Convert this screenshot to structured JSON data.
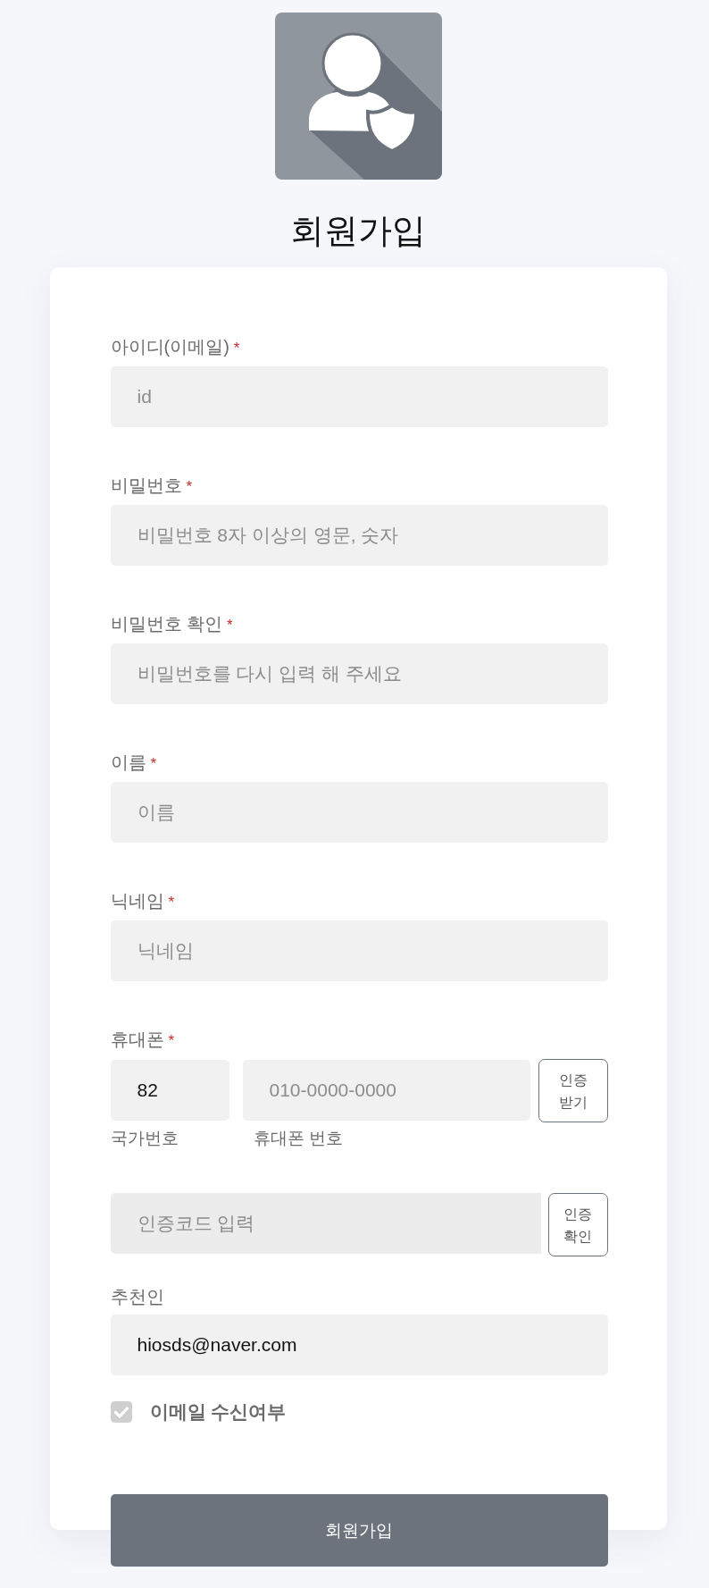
{
  "title": "회원가입",
  "fields": [
    {
      "kind": "text",
      "label": "아이디(이메일)",
      "required_mark": "*",
      "placeholder": "id"
    },
    {
      "kind": "password",
      "label": "비밀번호",
      "required_mark": "*",
      "placeholder": "비밀번호 8자 이상의 영문, 숫자"
    },
    {
      "kind": "password",
      "label": "비밀번호 확인",
      "required_mark": "*",
      "placeholder": "비밀번호를 다시 입력 해 주세요"
    },
    {
      "kind": "text",
      "label": "이름",
      "required_mark": "*",
      "placeholder": "이름"
    },
    {
      "kind": "text",
      "label": "닉네임",
      "required_mark": "*",
      "placeholder": "닉네임"
    },
    {
      "kind": "phone",
      "label": "휴대폰",
      "required_mark": "*",
      "country_code": {
        "value": "82",
        "caption": "국가번호"
      },
      "number": {
        "placeholder": "010-0000-0000",
        "caption": "휴대폰 번호"
      },
      "button": "인증 받기"
    },
    {
      "kind": "code",
      "placeholder": "인증코드 입력",
      "button": "인증 확인"
    },
    {
      "kind": "text",
      "label": "추천인",
      "value": "hiosds@naver.com"
    }
  ],
  "email_opt_in": {
    "label": "이메일 수신여부",
    "checked": true
  },
  "submit_button": "회원가입"
}
